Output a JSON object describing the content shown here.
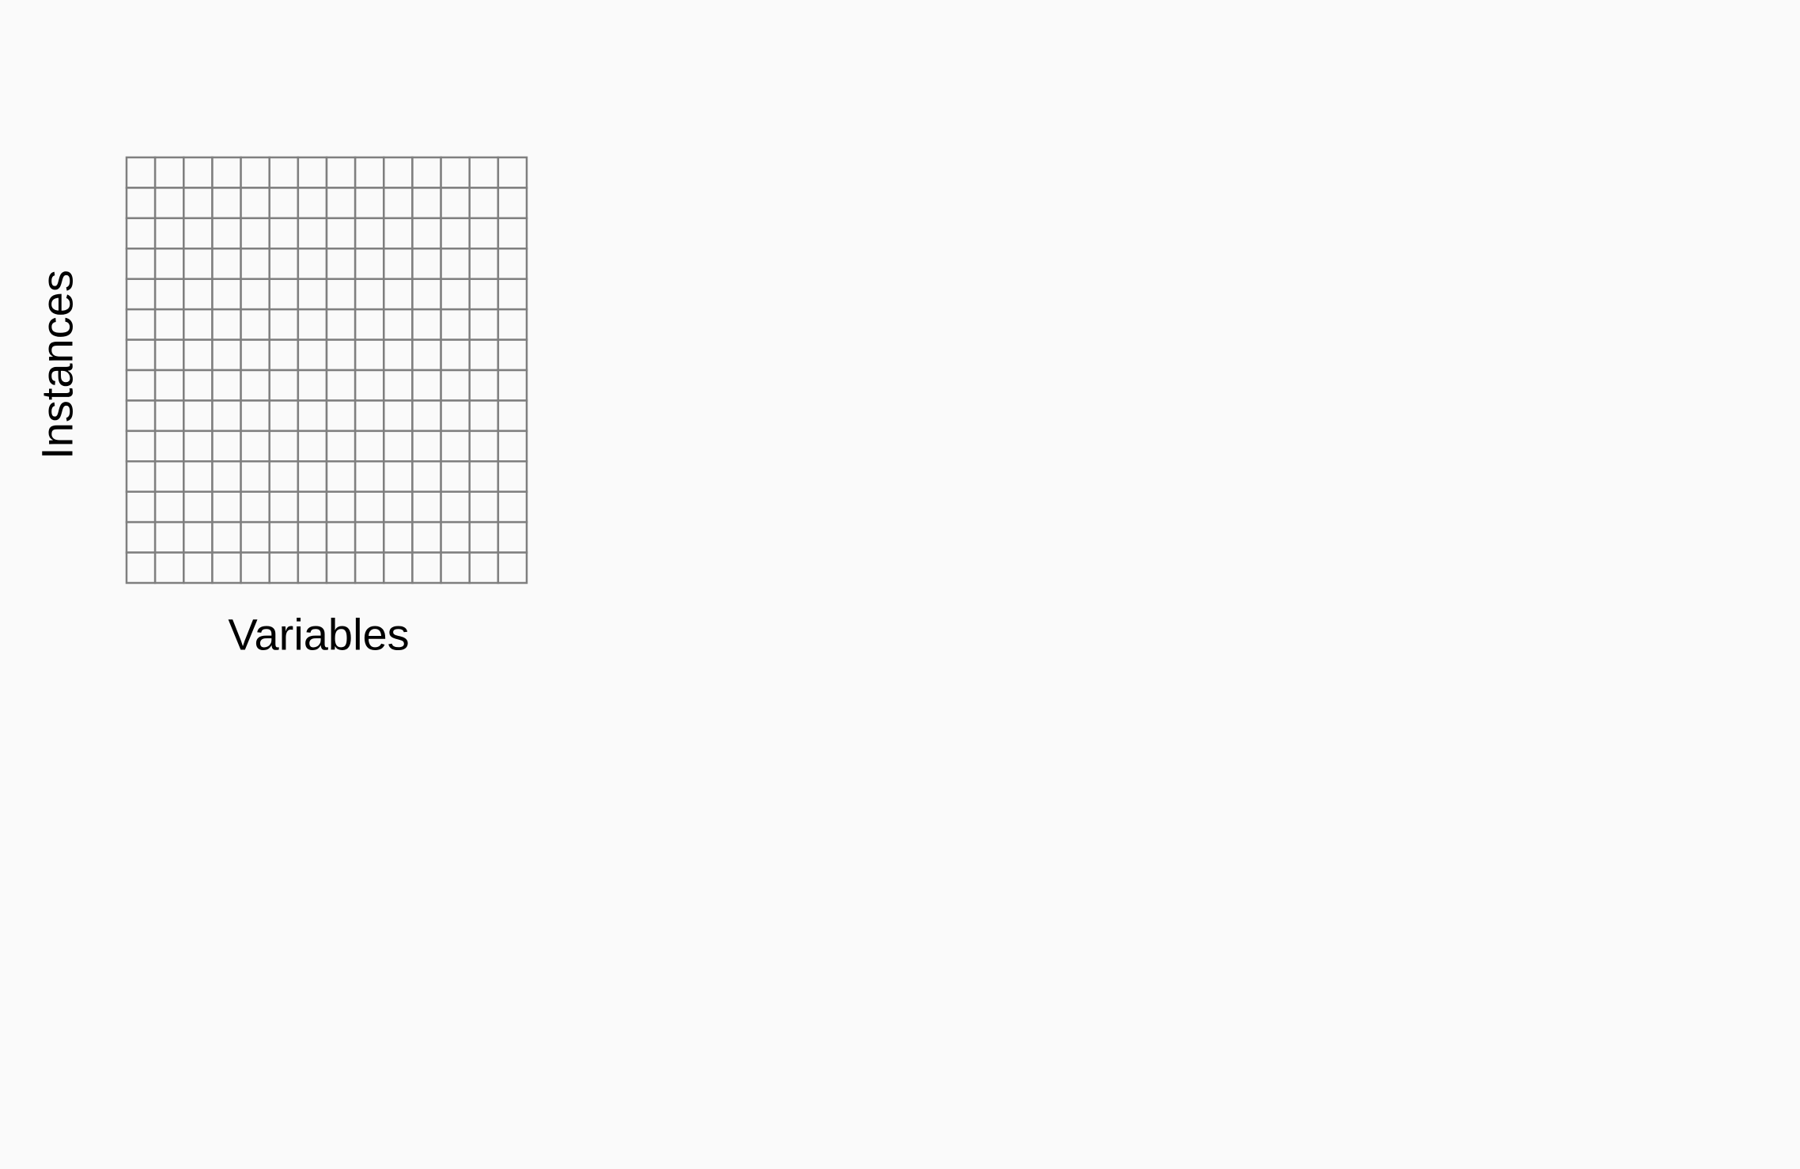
{
  "diagram": {
    "y_label": "Instances",
    "x_label": "Variables",
    "matrix": {
      "rows": 14,
      "cols": 14,
      "line_color": "#7f7f7f",
      "background_color": "#fafafa"
    }
  }
}
